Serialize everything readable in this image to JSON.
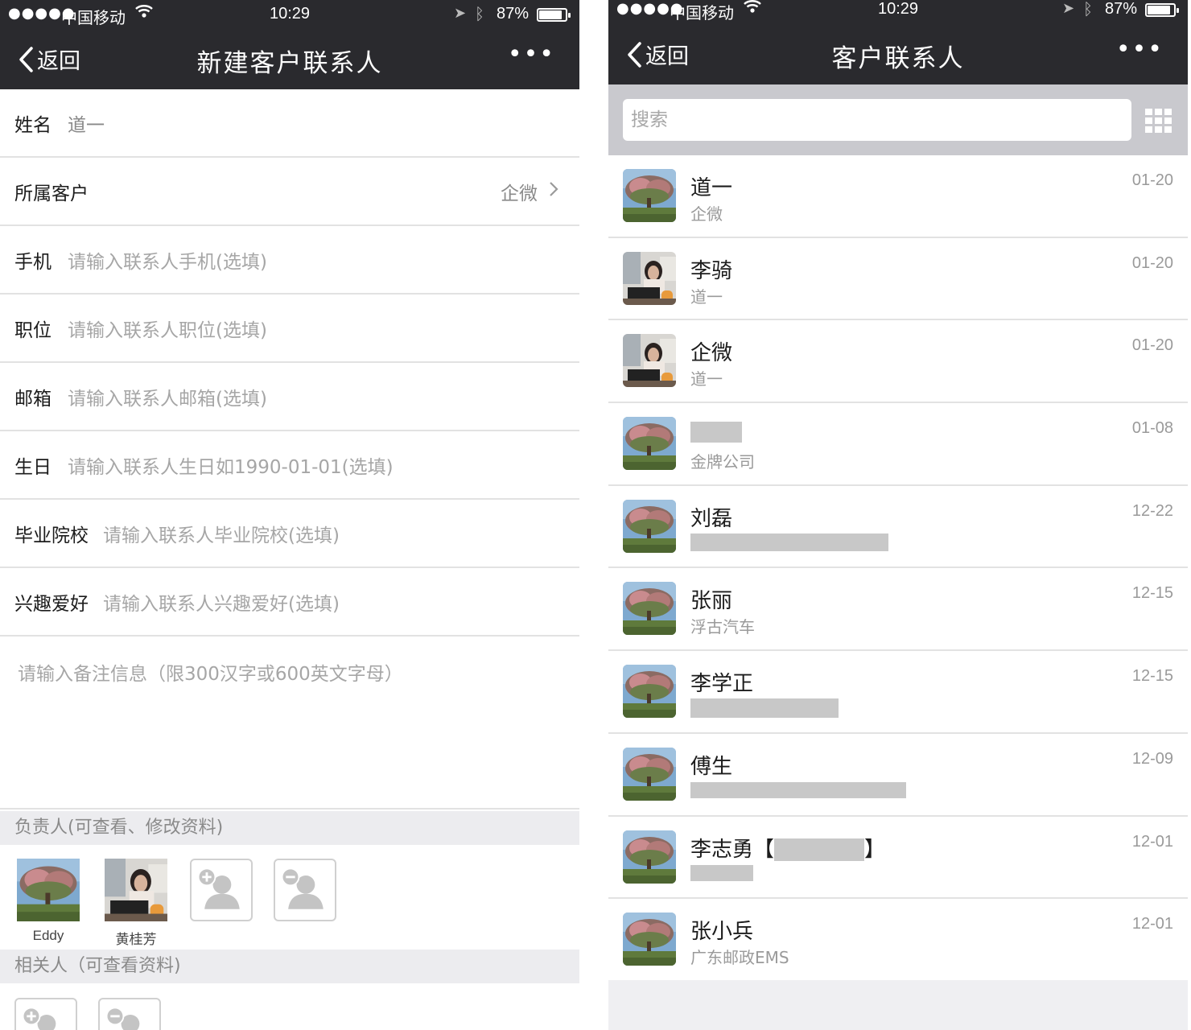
{
  "status_bar": {
    "signal": "●●●●●",
    "carrier": "中国移动",
    "time": "10:29",
    "battery": "87%",
    "battery_level": 0.87
  },
  "left": {
    "nav": {
      "back_label": "返回",
      "title": "新建客户联系人",
      "more": "•••"
    },
    "fields": {
      "name": {
        "label": "姓名",
        "value": "道一"
      },
      "customer": {
        "label": "所属客户",
        "value": "企微"
      },
      "mobile": {
        "label": "手机",
        "placeholder": "请输入联系人手机(选填)"
      },
      "position": {
        "label": "职位",
        "placeholder": "请输入联系人职位(选填)"
      },
      "email": {
        "label": "邮箱",
        "placeholder": "请输入联系人邮箱(选填)"
      },
      "birthday": {
        "label": "生日",
        "placeholder": "请输入联系人生日如1990-01-01(选填)"
      },
      "school": {
        "label": "毕业院校",
        "placeholder": "请输入联系人毕业院校(选填)"
      },
      "hobby": {
        "label": "兴趣爱好",
        "placeholder": "请输入联系人兴趣爱好(选填)"
      }
    },
    "notes_placeholder": "请输入备注信息（限300汉字或600英文字母）",
    "owner_section": {
      "title": "负责人(可查看、修改资料)",
      "members": [
        {
          "name": "Eddy",
          "avatar": "tree-photo"
        },
        {
          "name": "黄桂芳",
          "avatar": "person-photo"
        }
      ]
    },
    "related_section": {
      "title": "相关人（可查看资料)"
    }
  },
  "right": {
    "nav": {
      "back_label": "返回",
      "title": "客户联系人",
      "more": "•••"
    },
    "search": {
      "placeholder": "搜索"
    },
    "contacts": [
      {
        "name": "道一",
        "company": "企微",
        "date": "01-20",
        "avatar": "tree-photo"
      },
      {
        "name": "李骑",
        "company": "道一",
        "date": "01-20",
        "avatar": "person-photo"
      },
      {
        "name": "企微",
        "company": "道一",
        "date": "01-20",
        "avatar": "person-photo"
      },
      {
        "name": "",
        "company": "金牌公司",
        "date": "01-08",
        "avatar": "tree-photo"
      },
      {
        "name": "刘磊",
        "company": "",
        "date": "12-22",
        "avatar": "tree-photo"
      },
      {
        "name": "张丽",
        "company": "浮古汽车",
        "date": "12-15",
        "avatar": "tree-photo"
      },
      {
        "name": "李学正",
        "company": "",
        "date": "12-15",
        "avatar": "tree-photo"
      },
      {
        "name": "傅生",
        "company": "",
        "date": "12-09",
        "avatar": "tree-photo"
      },
      {
        "name": "李志勇【",
        "name_suffix": "】",
        "company": "",
        "date": "12-01",
        "avatar": "tree-photo"
      },
      {
        "name": "张小兵",
        "company": "广东邮政EMS",
        "date": "12-01",
        "avatar": "tree-photo"
      }
    ]
  },
  "colors": {
    "header_bg": "#2a2a2e",
    "section_bg": "#ececef",
    "search_bg": "#c9c9ce",
    "divider": "#e2e2e2",
    "secondary_text": "#9a9a9a"
  }
}
